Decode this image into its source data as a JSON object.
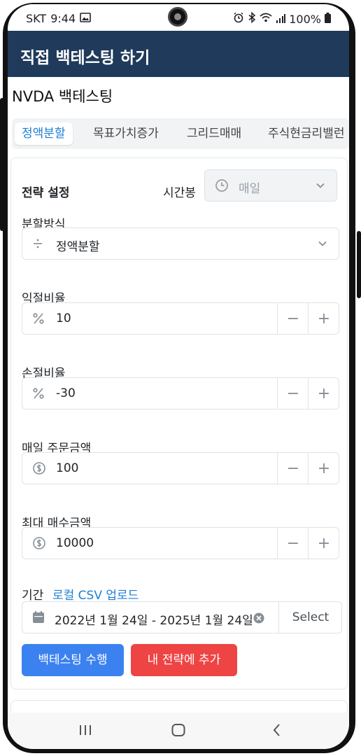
{
  "status_bar": {
    "carrier": "SKT",
    "time": "9:44",
    "battery": "100%",
    "icons": [
      "image-icon",
      "alarm-icon",
      "bluetooth-icon",
      "wifi-icon",
      "signal-icon",
      "battery-icon"
    ]
  },
  "app_bar": {
    "title": "직접 백테스팅 하기",
    "bg_color": "#1f3a5a"
  },
  "page_title": "NVDA 백테스팅",
  "tabs": [
    {
      "label": "정액분할",
      "active": true
    },
    {
      "label": "목표가치증가",
      "active": false
    },
    {
      "label": "그리드매매",
      "active": false
    },
    {
      "label": "주식현금리밸런",
      "active": false
    }
  ],
  "strategy": {
    "section_title": "전략 설정",
    "timeframe_label": "시간봉",
    "timeframe_value": "매일",
    "split_method": {
      "label": "분할방식",
      "icon": "divide-icon",
      "value": "정액분할"
    },
    "take_profit": {
      "label": "익절비율",
      "icon": "percent-icon",
      "value": "10"
    },
    "stop_loss": {
      "label": "손절비율",
      "icon": "percent-icon",
      "value": "-30"
    },
    "daily_order": {
      "label": "매일 주문금액",
      "icon": "dollar-icon",
      "value": "100"
    },
    "max_buy": {
      "label": "최대 매수금액",
      "icon": "dollar-icon",
      "value": "10000"
    },
    "stepper": {
      "minus": "−",
      "plus": "+"
    },
    "period": {
      "label": "기간",
      "csv_link": "로컬 CSV 업로드",
      "value": "2022년 1월 24일 - 2025년 1월 24일",
      "select_label": "Select"
    }
  },
  "buttons": {
    "run": "백테스팅 수행",
    "add": "내 전략에 추가",
    "run_color": "#3b82f0",
    "add_color": "#ef4444"
  },
  "accent_color": "#1c7ed6"
}
